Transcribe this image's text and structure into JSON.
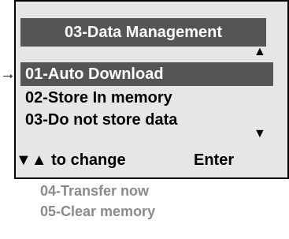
{
  "screen": {
    "title": "03-Data Management",
    "cursor_glyph": "→",
    "scroll_up_glyph": "▲",
    "scroll_down_glyph": "▼",
    "menu_items": [
      {
        "label": "01-Auto Download",
        "selected": true
      },
      {
        "label": "02-Store In memory",
        "selected": false
      },
      {
        "label": "03-Do not store data",
        "selected": false
      }
    ],
    "footer": {
      "change_label": "▼▲ to change",
      "enter_label": "Enter"
    }
  },
  "offscreen_items": [
    {
      "label": "04-Transfer now"
    },
    {
      "label": "05-Clear memory"
    }
  ],
  "colors": {
    "screen_bg": "#e6e6e6",
    "highlight_bg": "#555555",
    "highlight_text": "#ffffff",
    "offscreen_text": "#8a8a8a"
  }
}
